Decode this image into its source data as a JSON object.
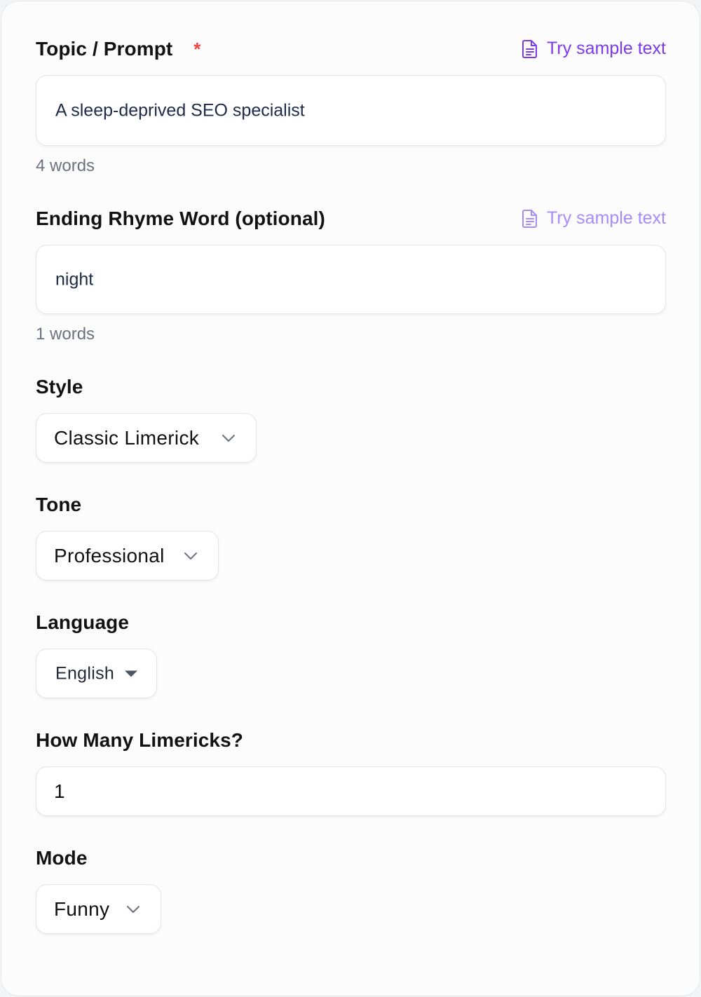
{
  "topic": {
    "label": "Topic / Prompt",
    "required_mark": "*",
    "sample_link": "Try sample text",
    "value": "A sleep-deprived SEO specialist",
    "word_count": "4 words"
  },
  "rhyme": {
    "label": "Ending Rhyme Word (optional)",
    "sample_link": "Try sample text",
    "value": "night",
    "word_count": "1 words"
  },
  "style": {
    "label": "Style",
    "selected": "Classic Limerick"
  },
  "tone": {
    "label": "Tone",
    "selected": "Professional"
  },
  "language": {
    "label": "Language",
    "selected": "English"
  },
  "count": {
    "label": "How Many Limericks?",
    "value": "1"
  },
  "mode": {
    "label": "Mode",
    "selected": "Funny"
  },
  "icons": {
    "sample": "document-icon",
    "chevron": "chevron-down-icon",
    "caret": "caret-down-icon"
  },
  "colors": {
    "accent": "#7c3aed",
    "accent_faded": "#a78bfa",
    "required": "#ef4444",
    "text": "#121212",
    "muted": "#6b7280"
  }
}
